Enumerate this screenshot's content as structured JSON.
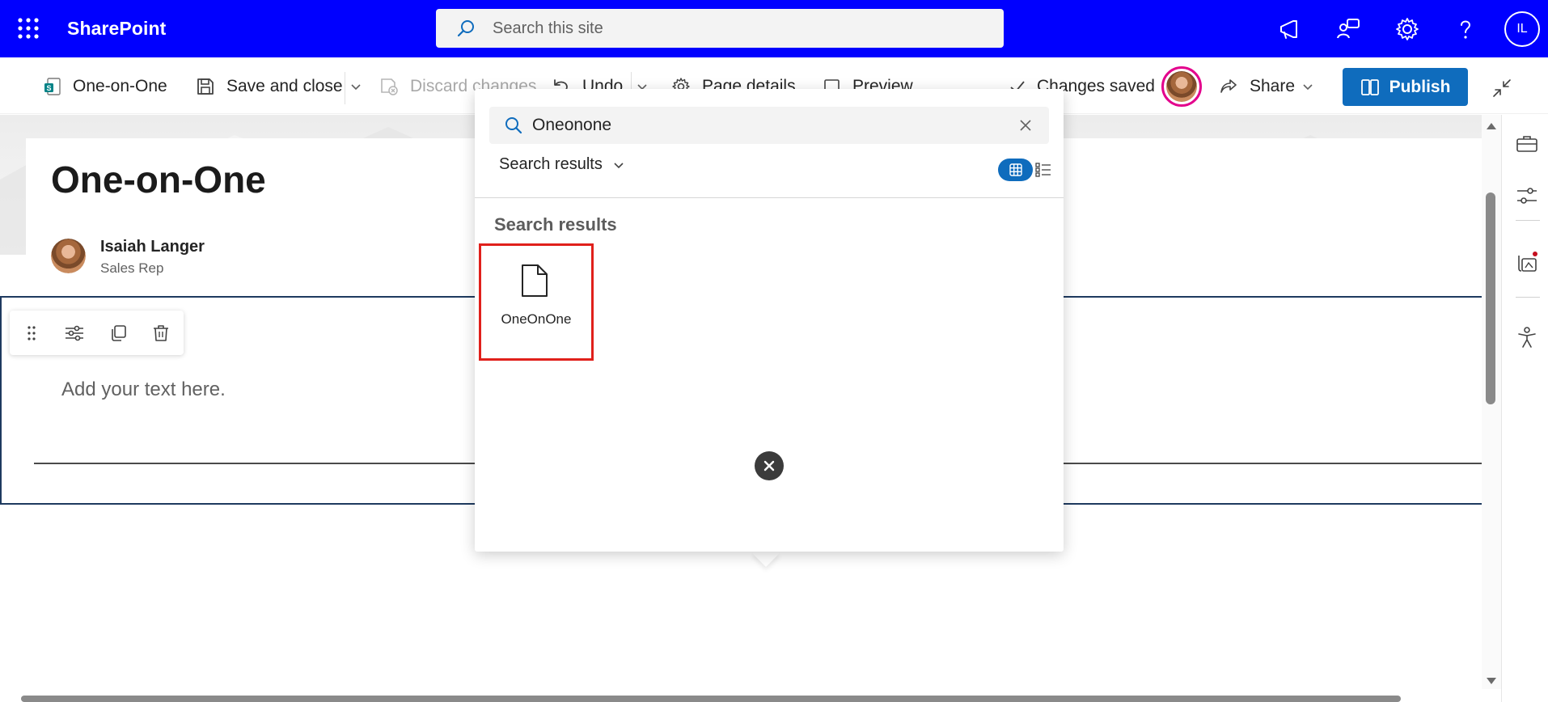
{
  "suite_bar": {
    "brand": "SharePoint",
    "search_placeholder": "Search this site",
    "avatar_initials": "IL",
    "icons": [
      "app-launcher-icon",
      "megaphone-icon",
      "people-icon",
      "gear-icon",
      "help-icon"
    ],
    "background": "#0000ff"
  },
  "command_bar": {
    "page_name": "One-on-One",
    "save_close": "Save and close",
    "discard": "Discard changes",
    "undo": "Undo",
    "page_details": "Page details",
    "preview": "Preview",
    "status": "Changes saved",
    "share": "Share",
    "publish": "Publish",
    "accent": "#0f6cbd"
  },
  "page": {
    "title": "One-on-One",
    "author_name": "Isaiah Langer",
    "author_role": "Sales Rep",
    "text_placeholder": "Add your text here."
  },
  "toolbox": {
    "query": "Oneonone",
    "filter_label": "Search results",
    "results_heading": "Search results",
    "results": [
      {
        "label": "OneOnOne",
        "icon": "document-icon"
      }
    ],
    "highlight_color": "#e0201b"
  },
  "right_rail": {
    "icons": [
      "toolbox-icon",
      "settings-sliders-icon",
      "design-ideas-icon",
      "accessibility-icon"
    ]
  }
}
